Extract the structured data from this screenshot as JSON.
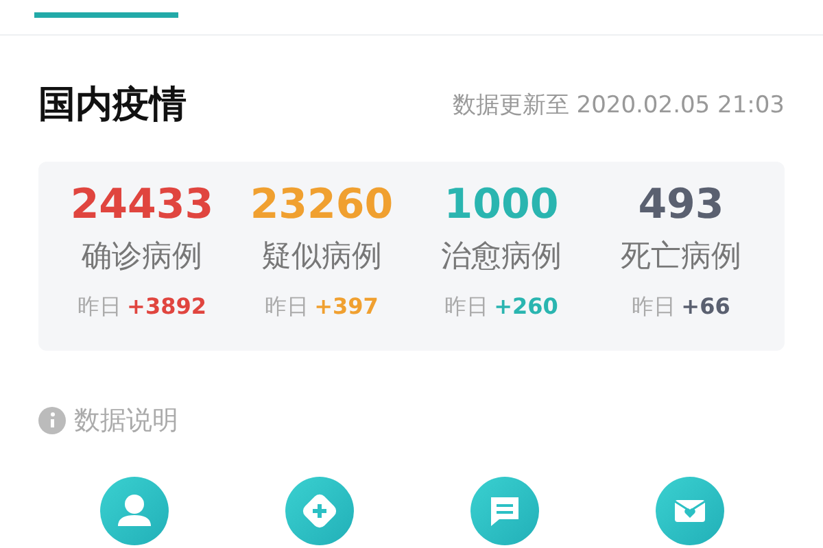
{
  "header": {
    "title": "国内疫情",
    "updated": "数据更新至 2020.02.05 21:03"
  },
  "stats": [
    {
      "value": "24433",
      "label": "确诊病例",
      "yesterday_label": "昨日",
      "yesterday_change": "+3892",
      "color": "#e0453f"
    },
    {
      "value": "23260",
      "label": "疑似病例",
      "yesterday_label": "昨日",
      "yesterday_change": "+397",
      "color": "#f0a030"
    },
    {
      "value": "1000",
      "label": "治愈病例",
      "yesterday_label": "昨日",
      "yesterday_change": "+260",
      "color": "#2ab5b0"
    },
    {
      "value": "493",
      "label": "死亡病例",
      "yesterday_label": "昨日",
      "yesterday_change": "+66",
      "color": "#5a6070"
    }
  ],
  "data_note": "数据说明",
  "shortcuts": [
    {
      "kind": "person"
    },
    {
      "kind": "diamond-plus"
    },
    {
      "kind": "chat"
    },
    {
      "kind": "envelope-heart"
    }
  ]
}
